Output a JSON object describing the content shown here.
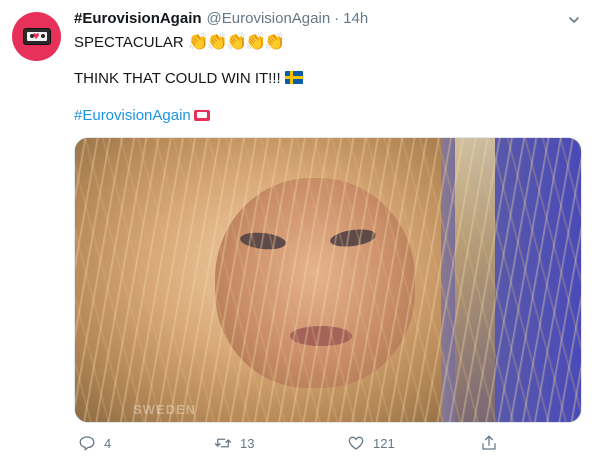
{
  "tweet": {
    "display_name": "#EurovisionAgain",
    "handle": "@EurovisionAgain",
    "separator": "·",
    "time": "14h",
    "line1_text": "SPECTACULAR",
    "line1_emoji": "👏👏👏👏👏",
    "line2_text": "THINK THAT COULD WIN IT!!!",
    "hashtag": "#EurovisionAgain",
    "media_watermark": "SWEDEN"
  },
  "actions": {
    "reply_count": "4",
    "retweet_count": "13",
    "like_count": "121"
  },
  "icons": {
    "avatar": "cassette-heart-icon",
    "more": "chevron-down-icon",
    "flag": "sweden-flag-icon",
    "reply": "reply-icon",
    "retweet": "retweet-icon",
    "like": "heart-icon",
    "share": "share-icon"
  },
  "colors": {
    "avatar_bg": "#e8315a",
    "hashtag": "#1b95e0",
    "muted": "#657786",
    "text": "#14171a"
  }
}
